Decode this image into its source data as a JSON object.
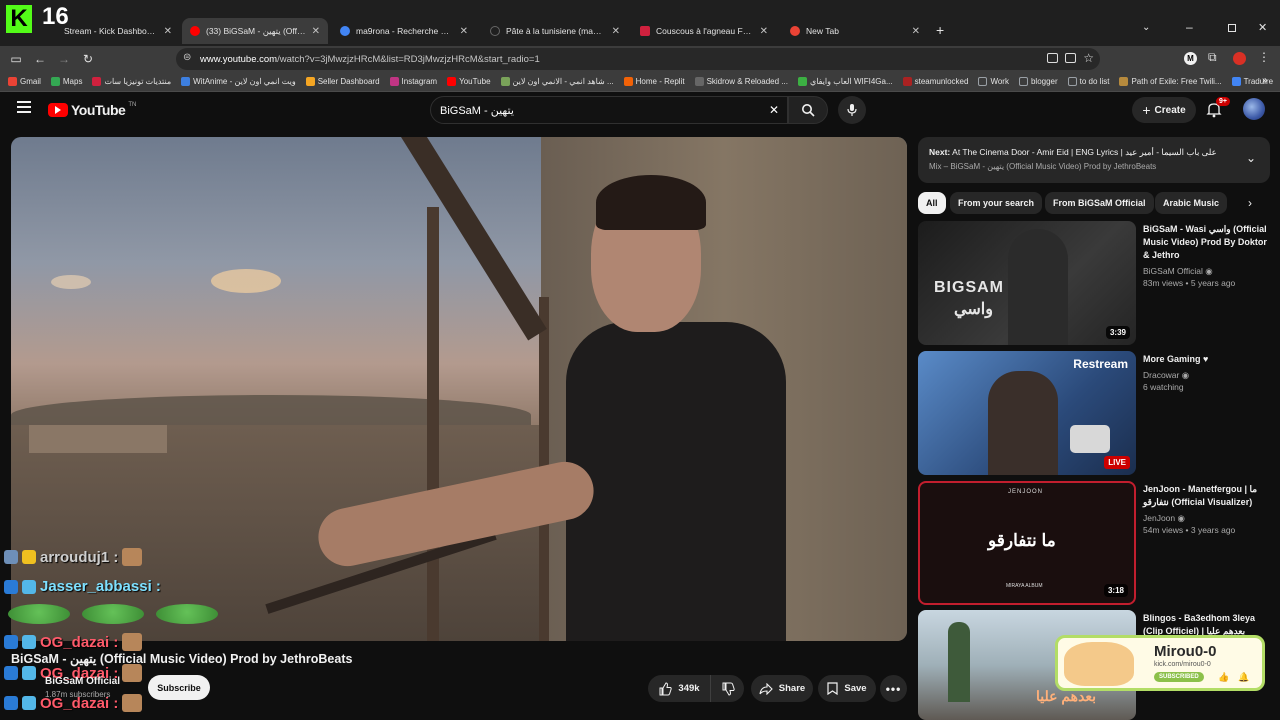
{
  "overlay": {
    "kick_logo": "K",
    "viewer_count": "16"
  },
  "tabs": [
    {
      "title": "Stream - Kick Dashboard",
      "favicon_color": "#53fc18"
    },
    {
      "title": "(33) BiGSaM - يتهين (Official Mu",
      "favicon_color": "#ff0000"
    },
    {
      "title": "ma9rona - Recherche Google",
      "favicon_color": "#4285f4"
    },
    {
      "title": "Pâte à la tunisiene (makrouna)",
      "favicon_color": "#888888"
    },
    {
      "title": "Couscous à l'agneau Facile et ra",
      "favicon_color": "#d0213e"
    },
    {
      "title": "New Tab",
      "favicon_color": "#ea4335"
    }
  ],
  "address": {
    "host": "www.youtube.com",
    "path": "/watch?v=3jMwzjzHRcM&list=RD3jMwzjzHRcM&start_radio=1"
  },
  "bookmarks": [
    {
      "label": "Gmail",
      "color": "#ea4335"
    },
    {
      "label": "Maps",
      "color": "#34a853"
    },
    {
      "label": "منتديات تونيزيا سات",
      "color": "#d0213e"
    },
    {
      "label": "WitAnime - ويت انمي اون لاين",
      "color": "#3d7fe0"
    },
    {
      "label": "Seller Dashboard",
      "color": "#f5a623"
    },
    {
      "label": "Instagram",
      "color": "#c13584"
    },
    {
      "label": "YouTube",
      "color": "#ff0000"
    },
    {
      "label": "شاهد انمي - الانمي اون لاين ...",
      "color": "#7aa35a"
    },
    {
      "label": "Home - Replit",
      "color": "#f26207"
    },
    {
      "label": "Skidrow & Reloaded ...",
      "color": "#666666"
    },
    {
      "label": "العاب وايفاي WIFI4Ga...",
      "color": "#3cb043"
    },
    {
      "label": "steamunlocked",
      "color": "#aa2222"
    },
    {
      "label": "Work",
      "color": "#9aa0a6"
    },
    {
      "label": "blogger",
      "color": "#9aa0a6"
    },
    {
      "label": "to do list",
      "color": "#9aa0a6"
    },
    {
      "label": "Path of Exile: Free Twili...",
      "color": "#b68a3d"
    },
    {
      "label": "Traduire",
      "color": "#4285f4"
    }
  ],
  "youtube": {
    "logo_text": "YouTube",
    "logo_sup": "TN",
    "search_value": "BiGSaM - يتهين",
    "create_label": "Create",
    "notif_badge": "9+"
  },
  "next": {
    "label": "Next:",
    "title": "At The Cinema Door - Amir Eid | ENG Lyrics | على باب السيما - أمير عيد",
    "playlist": "Mix – BiGSaM - يتهين (Official Music Video) Prod by JethroBeats"
  },
  "chips": [
    "All",
    "From your search",
    "From BiGSaM Official",
    "Arabic Music"
  ],
  "recommendations": [
    {
      "title": "BiGSaM - Wasi واسي (Official Music Video) Prod By Doktor & Jethro",
      "channel": "BiGSaM Official",
      "views": "83m views • 5 years ago",
      "duration": "3:39",
      "thumb_text": "BIGSAM",
      "thumb_text2": "واسي"
    },
    {
      "title": "More Gaming ♥",
      "channel": "Dracowar",
      "views": "6 watching",
      "badge": "LIVE",
      "thumb_text": "Restream"
    },
    {
      "title": "JenJoon - Manetfergou | ما نتفارقو (Official Visualizer)",
      "channel": "JenJoon",
      "views": "54m views • 3 years ago",
      "duration": "3:18",
      "thumb_text": "ما نتفارقو",
      "thumb_top": "JENJOON",
      "thumb_bottom": "MIRAYA ALBUM"
    },
    {
      "title": "Blingos - Ba3edhom 3leya (Clip Officiel) | بعدهم عليا",
      "channel": "",
      "views": "",
      "thumb_text": "بعدهم عليا"
    }
  ],
  "video": {
    "title": "BiGSaM - يتهين (Official Music Video) Prod by JethroBeats",
    "channel": "BiGSaM Official",
    "subscribers": "1.87m subscribers",
    "subscribe_label": "Subscribe",
    "likes": "349k",
    "share_label": "Share",
    "save_label": "Save"
  },
  "chat": [
    {
      "user": "arrouduj1 :"
    },
    {
      "user": "Jasser_abbassi :",
      "color": "#7ee0ff"
    },
    {
      "user": "OG_dazai :",
      "color": "#ff5a6a"
    },
    {
      "user": "OG_dazai :",
      "color": "#ff5a6a"
    },
    {
      "user": "OG_dazai :",
      "color": "#ff5a6a"
    }
  ],
  "stream_card": {
    "name": "Mirou0-0",
    "url": "kick.com/mirou0-0",
    "subscribed": "SUBSCRIBED"
  }
}
